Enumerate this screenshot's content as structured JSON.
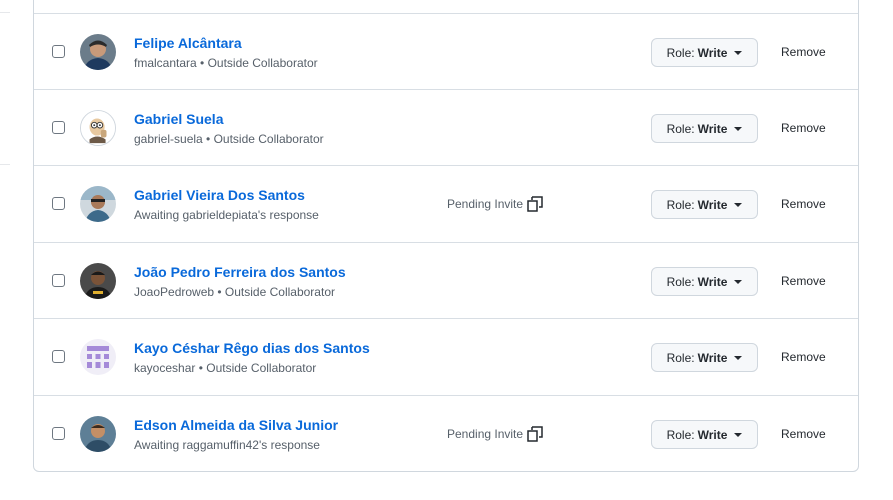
{
  "role_prefix": "Role:",
  "remove_label": "Remove",
  "collaborators": [
    {
      "name": "Felipe Alcântara",
      "sub": "fmalcantara • Outside Collaborator",
      "pending": "",
      "role": "Write",
      "avatar": "photo-avatar"
    },
    {
      "name": "Gabriel Suela",
      "sub": "gabriel-suela • Outside Collaborator",
      "pending": "",
      "role": "Write",
      "avatar": "cartoon-avatar"
    },
    {
      "name": "Gabriel Vieira Dos Santos",
      "sub": "Awaiting gabrieldepiata's response",
      "pending": "Pending Invite",
      "role": "Write",
      "avatar": "photo-avatar"
    },
    {
      "name": "João Pedro Ferreira dos Santos",
      "sub": "JoaoPedroweb • Outside Collaborator",
      "pending": "",
      "role": "Write",
      "avatar": "photo-avatar"
    },
    {
      "name": "Kayo Céshar Rêgo dias dos Santos",
      "sub": "kayoceshar • Outside Collaborator",
      "pending": "",
      "role": "Write",
      "avatar": "identicon-avatar"
    },
    {
      "name": "Edson Almeida da Silva Junior",
      "sub": "Awaiting raggamuffin42's response",
      "pending": "Pending Invite",
      "role": "Write",
      "avatar": "photo-avatar"
    }
  ],
  "colors": {
    "link": "#0969da",
    "muted": "#57606a",
    "border": "#d0d7de"
  }
}
